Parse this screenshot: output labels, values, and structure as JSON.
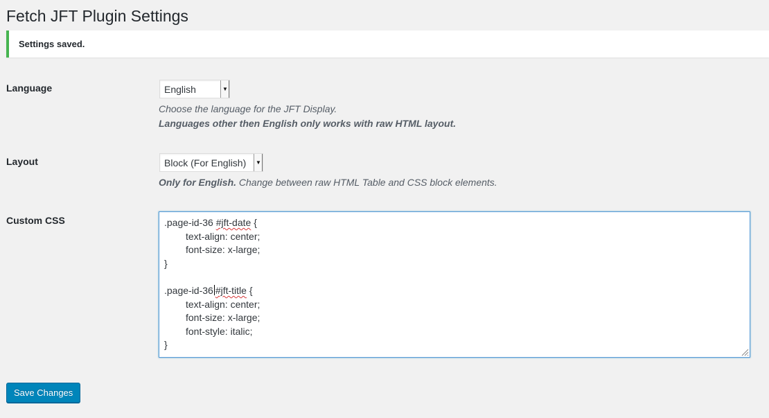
{
  "page": {
    "title": "Fetch JFT Plugin Settings"
  },
  "notice": {
    "text": "Settings saved.",
    "accent_color": "#46b450"
  },
  "language": {
    "label": "Language",
    "selected": "English",
    "description": "Choose the language for the JFT Display.",
    "note": "Languages other then English only works with raw HTML layout."
  },
  "layout": {
    "label": "Layout",
    "selected": "Block (For English)",
    "description_bold": "Only for English.",
    "description": " Change between raw HTML Table and CSS block elements."
  },
  "custom_css": {
    "label": "Custom CSS",
    "lines": [
      ".page-id-36 ",
      "#jft-date",
      " {",
      "text-align: center;",
      "font-size: x-large;",
      "}",
      "",
      ".page-id-36",
      "#jft-title",
      " {",
      "text-align: center;",
      "font-size: x-large;",
      "font-style: italic;",
      "}"
    ]
  },
  "actions": {
    "save_label": "Save Changes",
    "button_color": "#0085ba"
  }
}
